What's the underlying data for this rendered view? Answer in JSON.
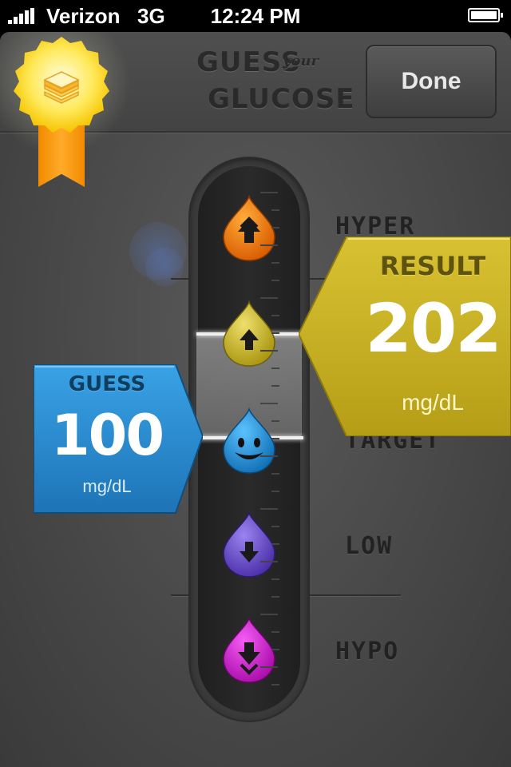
{
  "status_bar": {
    "carrier": "Verizon",
    "network": "3G",
    "time": "12:24 PM"
  },
  "header": {
    "title_line1": "GUESS",
    "title_word": "your",
    "title_line2": "GLUCOSE",
    "done_label": "Done"
  },
  "zones": {
    "hyper": "HYPER",
    "target": "TARGET",
    "low": "LOW",
    "hypo": "HYPO"
  },
  "result": {
    "title": "RESULT",
    "value": "202",
    "unit": "mg/dL"
  },
  "guess": {
    "title": "GUESS",
    "value": "100",
    "unit": "mg/dL"
  },
  "colors": {
    "hyper_drop": "#f07a10",
    "high_drop": "#c9b21f",
    "target_drop": "#1f8fd6",
    "low_drop": "#6a48c9",
    "hypo_drop": "#d620d6",
    "result_flag": "#c6b021",
    "guess_flag": "#2c8ed0",
    "badge_ribbon": "#f28a00"
  },
  "icons": {
    "hyper": "double-up-arrow-icon",
    "high": "up-arrow-icon",
    "target": "smiley-face-icon",
    "low": "down-arrow-icon",
    "hypo": "double-down-arrow-icon",
    "badge": "sandwich-award-icon"
  }
}
